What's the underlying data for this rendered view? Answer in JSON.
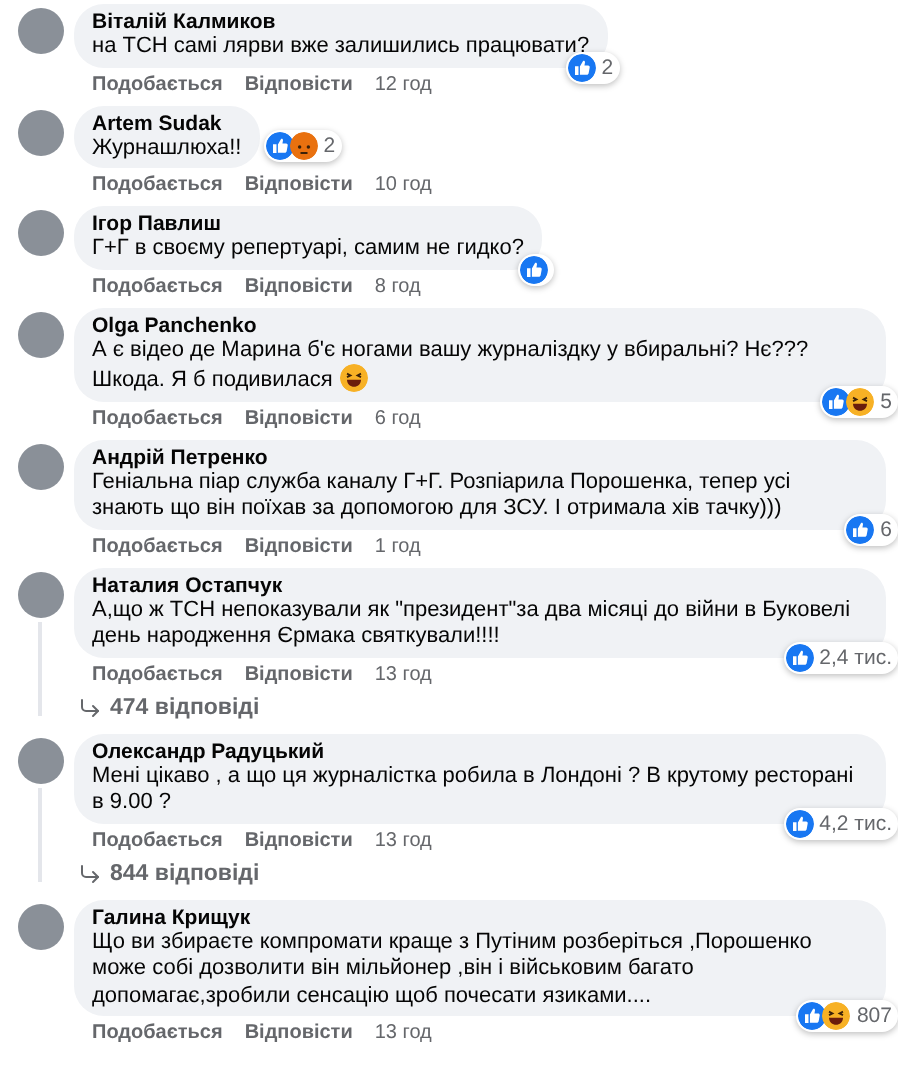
{
  "comments": [
    {
      "author": "Віталій Калмиков",
      "text": "на ТСН самі лярви вже залишились працювати?",
      "like_label": "Подобається",
      "reply_label": "Відповісти",
      "time": "12 год",
      "reaction_badge": {
        "kind": "corner",
        "icons": [
          {
            "kind": "like"
          }
        ],
        "count": "2"
      }
    },
    {
      "author": "Artem Sudak",
      "text": "Журнашлюха!!",
      "like_label": "Подобається",
      "reply_label": "Відповісти",
      "time": "10 год",
      "reaction_badge": {
        "kind": "side",
        "icons": [
          {
            "kind": "like"
          },
          {
            "kind": "angry"
          }
        ],
        "count": "2"
      }
    },
    {
      "author": "Ігор Павлиш",
      "text": "Г+Г в своєму репертуарі, самим не гидко?",
      "like_label": "Подобається",
      "reply_label": "Відповісти",
      "time": "8 год",
      "reaction_badge": {
        "kind": "corner",
        "icons": [
          {
            "kind": "like"
          }
        ]
      }
    },
    {
      "author": "Olga Panchenko",
      "text": "А є відео де Марина б'є ногами вашу журналіздку у вбиральні? Нє??? Шкода. Я б подивилася",
      "emoji": {
        "kind": "laugh"
      },
      "like_label": "Подобається",
      "reply_label": "Відповісти",
      "time": "6 год",
      "reaction_badge": {
        "kind": "corner",
        "icons": [
          {
            "kind": "like"
          },
          {
            "kind": "haha"
          }
        ],
        "count": "5"
      }
    },
    {
      "author": "Андрій Петренко",
      "text": "Геніальна піар служба каналу Г+Г. Розпіарила Порошенка, тепер усі знають що він поїхав за допомогою для ЗСУ. І отримала хів тачку)))",
      "like_label": "Подобається",
      "reply_label": "Відповісти",
      "time": "1 год",
      "reaction_badge": {
        "kind": "corner",
        "icons": [
          {
            "kind": "like"
          }
        ],
        "count": "6"
      }
    },
    {
      "author": "Наталия Остапчук",
      "text": "А,що ж ТСН непоказували як \"президент\"за два місяці до війни в Буковелі день народження Єрмака святкували!!!!",
      "like_label": "Подобається",
      "reply_label": "Відповісти",
      "time": "13 год",
      "reaction_badge": {
        "kind": "corner",
        "icons": [
          {
            "kind": "like"
          }
        ],
        "count": "2,4 тис."
      },
      "replies": "474 відповіді"
    },
    {
      "author": "Олександр Радуцький",
      "text": "Мені цікаво , а що ця журналістка робила в Лондоні ? В крутому ресторані в 9.00 ?",
      "like_label": "Подобається",
      "reply_label": "Відповісти",
      "time": "13 год",
      "reaction_badge": {
        "kind": "corner",
        "icons": [
          {
            "kind": "like"
          }
        ],
        "count": "4,2 тис."
      },
      "replies": "844 відповіді"
    },
    {
      "author": "Галина Крищук",
      "text": "Що ви збираєте компромати краще з Путіним розберіться ,Порошенко може собі дозволити він мільйонер ,він і військовим багато допомагає,зробили сенсацію щоб почесати язиками....",
      "like_label": "Подобається",
      "reply_label": "Відповісти",
      "time": "13 год",
      "reaction_badge": {
        "kind": "corner",
        "icons": [
          {
            "kind": "like"
          },
          {
            "kind": "haha"
          }
        ],
        "count": "807"
      }
    }
  ]
}
